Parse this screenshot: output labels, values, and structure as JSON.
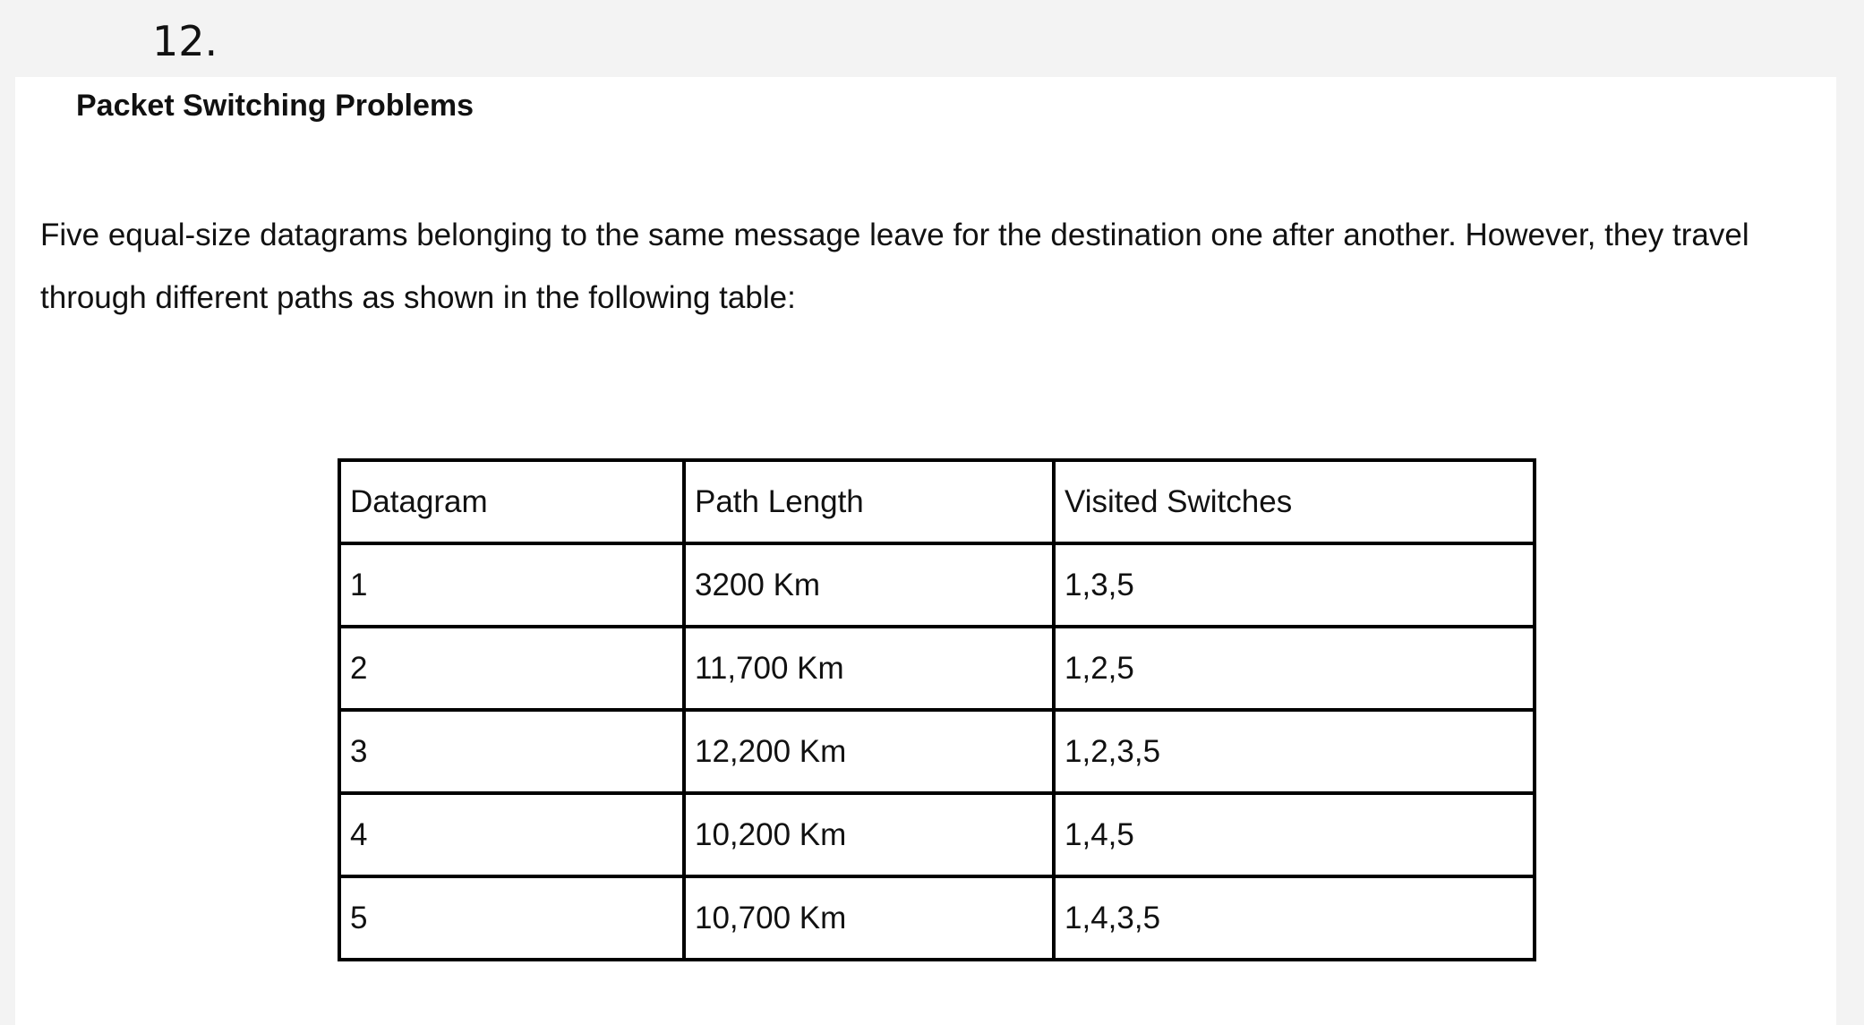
{
  "question_number": "12.",
  "document": {
    "title": "Packet Switching Problems",
    "paragraph_lines": [
      "Five equal-size datagrams belonging to the same message leave for the destination one after another. However, they travel",
      "through different paths as shown in the following table:"
    ]
  },
  "table": {
    "headers": [
      "Datagram",
      "Path Length",
      "Visited Switches"
    ],
    "rows": [
      [
        "1",
        "3200 Km",
        "1,3,5"
      ],
      [
        "2",
        "11,700 Km",
        "1,2,5"
      ],
      [
        "3",
        "12,200 Km",
        "1,2,3,5"
      ],
      [
        "4",
        "10,200 Km",
        "1,4,5"
      ],
      [
        "5",
        "10,700 Km",
        "1,4,3,5"
      ]
    ]
  }
}
